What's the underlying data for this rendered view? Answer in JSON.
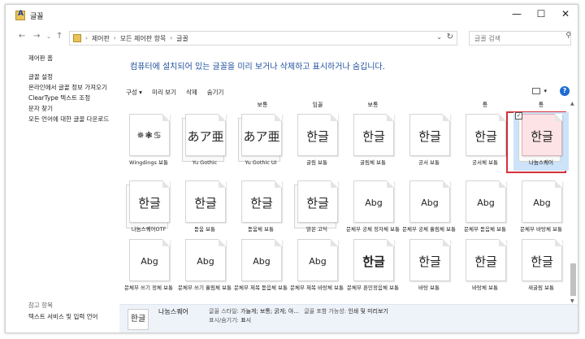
{
  "window": {
    "title": "글꼴",
    "controls": [
      "—",
      "☐",
      "✕"
    ]
  },
  "address": {
    "crumbs": [
      "제어판",
      "모든 제어판 항목",
      "글꼴"
    ],
    "search_placeholder": "글꼴 검색"
  },
  "left": {
    "home": "제어판 홈",
    "links": [
      "글꼴 설정",
      "온라인에서 글꼴 정보 가져오기",
      "ClearType 텍스트 조정",
      "문자 찾기",
      "모든 언어에 대한 글꼴 다운로드"
    ],
    "see_also_title": "참고 항목",
    "see_also_item": "텍스트 서비스 및 입력 언어"
  },
  "heading": "컴퓨터에 설치되어 있는 글꼴을 미리 보거나 삭제하고 표시하거나 숨깁니다.",
  "toolbar": {
    "organize": "구성 ▾",
    "preview": "미리 보기",
    "delete": "삭제",
    "hide": "숨기기"
  },
  "top_labels": [
    "보통",
    "임꼴",
    "보통",
    "",
    "",
    "통",
    "통"
  ],
  "fonts": [
    {
      "sample": "✵❃♋",
      "label": "Wingdings 보통",
      "kind": "wing",
      "stack": false
    },
    {
      "sample": "あア亜",
      "label": "Yu Gothic",
      "kind": "",
      "stack": true
    },
    {
      "sample": "あア亜",
      "label": "Yu Gothic UI",
      "kind": "",
      "stack": true
    },
    {
      "sample": "한글",
      "label": "굴림 보통",
      "kind": "",
      "stack": false
    },
    {
      "sample": "한글",
      "label": "굴림체 보통",
      "kind": "",
      "stack": false
    },
    {
      "sample": "한글",
      "label": "궁서 보통",
      "kind": "",
      "stack": false
    },
    {
      "sample": "한글",
      "label": "궁서체 보통",
      "kind": "",
      "stack": false
    },
    {
      "sample": "한글",
      "label": "나눔스퀘어",
      "kind": "",
      "stack": true,
      "selected": true
    },
    {
      "sample": "한글",
      "label": "나눔스퀘어OTF",
      "kind": "",
      "stack": true
    },
    {
      "sample": "한글",
      "label": "돋움 보통",
      "kind": "",
      "stack": false
    },
    {
      "sample": "한글",
      "label": "돋움체 보통",
      "kind": "",
      "stack": false
    },
    {
      "sample": "한글",
      "label": "맑은 고딕",
      "kind": "",
      "stack": true
    },
    {
      "sample": "Abg",
      "label": "문체부 궁체 정자체 보통",
      "kind": "abg",
      "stack": false
    },
    {
      "sample": "Abg",
      "label": "문체부 궁체 흘림체 보통",
      "kind": "abg",
      "stack": false
    },
    {
      "sample": "Abg",
      "label": "문체부 돋음체 보통",
      "kind": "abg",
      "stack": false
    },
    {
      "sample": "Abg",
      "label": "문체부 바탕체 보통",
      "kind": "abg",
      "stack": false
    },
    {
      "sample": "Abg",
      "label": "문체부 쓰기 정체 보통",
      "kind": "abg",
      "stack": false
    },
    {
      "sample": "Abg",
      "label": "문체부 쓰기 흘림체 보통",
      "kind": "abg",
      "stack": false
    },
    {
      "sample": "Abg",
      "label": "문체부 제목 돋음체 보통",
      "kind": "abg",
      "stack": false
    },
    {
      "sample": "Abg",
      "label": "문체부 제목 바탕체 보통",
      "kind": "abg",
      "stack": false
    },
    {
      "sample": "한글",
      "label": "문체부 훈민정음체 보통",
      "kind": "bold",
      "stack": false
    },
    {
      "sample": "한글",
      "label": "바탕 보통",
      "kind": "",
      "stack": false
    },
    {
      "sample": "한글",
      "label": "바탕체 보통",
      "kind": "",
      "stack": false
    },
    {
      "sample": "한글",
      "label": "새굴림 보통",
      "kind": "",
      "stack": false
    }
  ],
  "details": {
    "thumb": "한글",
    "name": "나눔스퀘어",
    "style_label": "글꼴 스타일:",
    "style_value": "가늘게; 보통; 굵게; 아...",
    "embed_label": "글꼴 포함 가능성:",
    "embed_value": "인쇄 및 미리보기",
    "show_label": "표시/숨기기:",
    "show_value": "표시"
  }
}
